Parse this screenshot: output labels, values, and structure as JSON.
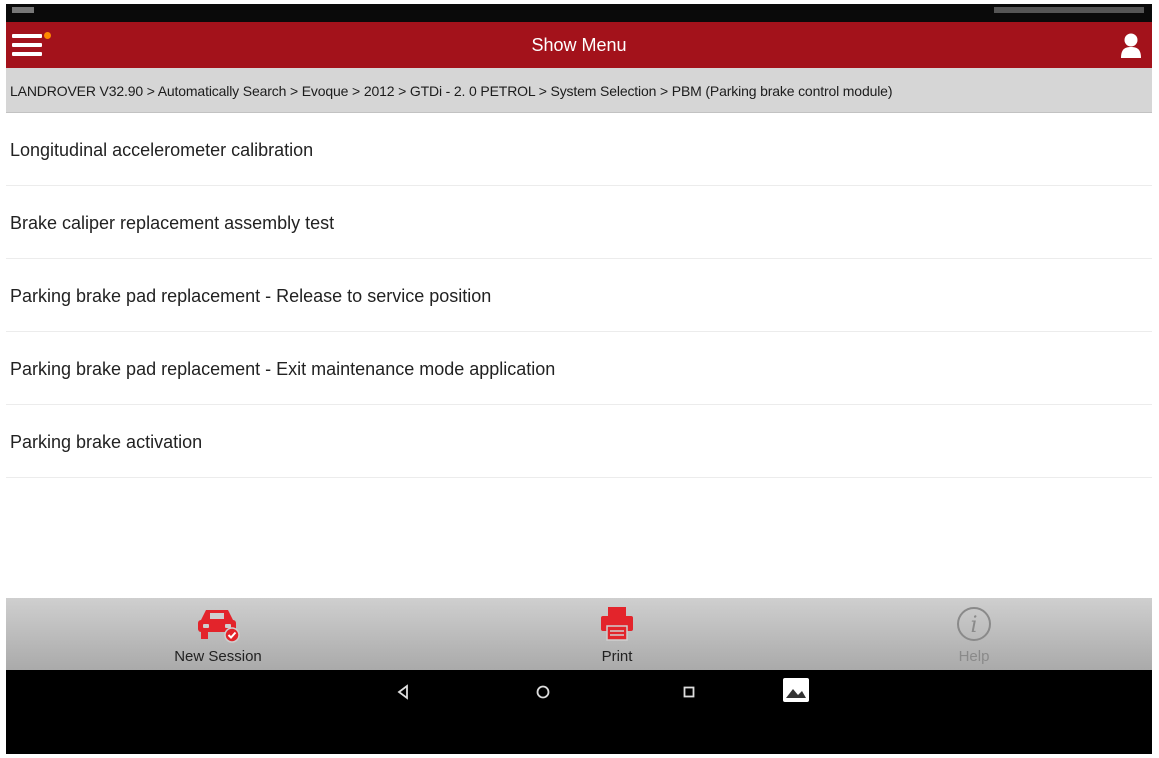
{
  "appbar": {
    "title": "Show Menu"
  },
  "breadcrumb": "LANDROVER V32.90 > Automatically Search > Evoque > 2012 > GTDi - 2. 0 PETROL > System Selection > PBM (Parking brake control module)",
  "menu_items": [
    "Longitudinal accelerometer calibration",
    "Brake caliper replacement assembly test",
    "Parking brake pad replacement - Release to service position",
    "Parking brake pad replacement - Exit maintenance mode application",
    "Parking brake activation"
  ],
  "toolbar": {
    "new_session_label": "New Session",
    "print_label": "Print",
    "help_label": "Help"
  },
  "icons": {
    "menu": "hamburger-icon",
    "user": "user-icon",
    "new_session": "car-check-icon",
    "print": "printer-icon",
    "help": "info-icon",
    "nav_back": "back-triangle-icon",
    "nav_home": "home-circle-icon",
    "nav_recents": "recents-square-icon",
    "nav_gallery": "gallery-icon"
  },
  "colors": {
    "appbar": "#a3121b",
    "accent_red": "#e3242b",
    "notification_dot": "#ff8a00",
    "breadcrumb_bg": "#d6d6d6"
  }
}
